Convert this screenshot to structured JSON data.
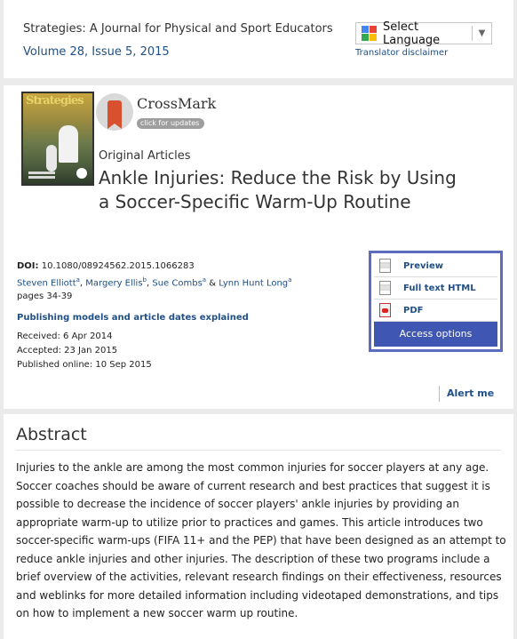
{
  "header": {
    "journal_name": "Strategies: A Journal for Physical and Sport Educators",
    "issue": "Volume 28, Issue 5, 2015",
    "language_select": {
      "label": "Select Language",
      "arrow": "▼"
    },
    "translator_disclaimer": "Translator disclaimer"
  },
  "article": {
    "cover": {
      "title_text": "Strategies"
    },
    "crossmark": {
      "label": "CrossMark",
      "sublabel": "click for updates"
    },
    "type": "Original Articles",
    "title": "Ankle Injuries: Reduce the Risk by Using a Soccer-Specific Warm-Up Routine",
    "doi_label": "DOI:",
    "doi": "10.1080/08924562.2015.1066283",
    "authors": [
      {
        "name": "Steven Elliott",
        "affil": "a"
      },
      {
        "name": "Margery Ellis",
        "affil": "b"
      },
      {
        "name": "Sue Combs",
        "affil": "a"
      },
      {
        "name": "Lynn Hunt Long",
        "affil": "a"
      }
    ],
    "author_sep_1": ", ",
    "author_sep_2": ", ",
    "author_sep_3": " & ",
    "pages": "pages 34-39",
    "models_link": "Publishing models and article dates explained",
    "received": "Received: 6 Apr 2014",
    "accepted": "Accepted: 23 Jan 2015",
    "published": "Published online: 10 Sep 2015"
  },
  "access": {
    "items": [
      {
        "label": "Preview",
        "icon": "document-icon"
      },
      {
        "label": "Full text HTML",
        "icon": "document-icon"
      },
      {
        "label": "PDF",
        "icon": "pdf-icon"
      }
    ],
    "button": "Access options"
  },
  "alert": {
    "label": "Alert me"
  },
  "abstract": {
    "heading": "Abstract",
    "body": "Injuries to the ankle are among the most common injuries for soccer players at any age. Soccer coaches should be aware of current research and best practices that suggest it is possible to decrease the incidence of soccer players' ankle injuries by providing an appropriate warm-up to utilize prior to practices and games. This article introduces two soccer-specific warm-ups (FIFA 11+ and the PEP) that have been designed as an attempt to reduce ankle injuries and other injuries. The description of these two programs include a brief overview of the activities, relevant research findings on their effectiveness, resources and weblinks for more detailed information including videotaped demonstrations, and tips on how to implement a new soccer warm up routine."
  },
  "colors": {
    "link": "#1f4f86",
    "access_border": "#5b6bbf",
    "access_button": "#3f56b3"
  }
}
